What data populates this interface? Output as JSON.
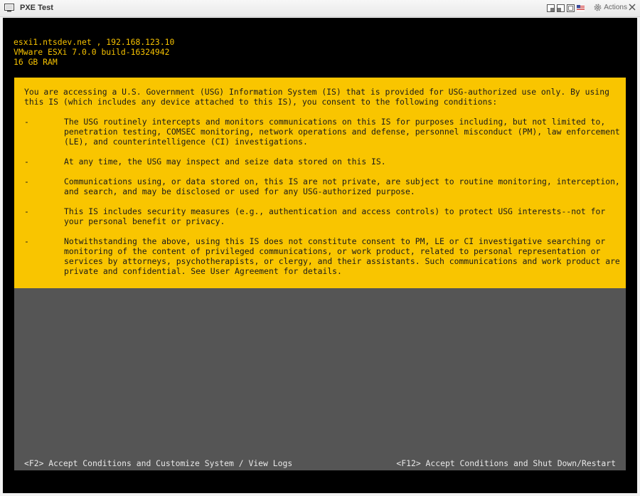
{
  "window": {
    "title": "PXE Test",
    "actions_label": "Actions"
  },
  "console": {
    "host_line": "esxi1.ntsdev.net , 192.168.123.10",
    "version_line": "VMware ESXi 7.0.0 build-16324942",
    "ram_line": "16 GB RAM",
    "banner": {
      "intro": "You are accessing a U.S. Government (USG) Information System (IS) that is provided for USG-authorized use only. By using this IS (which includes any device attached to this IS), you consent to the following conditions:",
      "bullets": [
        {
          "dash": "-",
          "text": "The USG routinely intercepts and monitors communications on this IS for purposes including, but not limited to, penetration testing, COMSEC monitoring, network operations and defense, personnel misconduct (PM), law enforcement (LE), and counterintelligence (CI) investigations."
        },
        {
          "dash": "-",
          "text": "At any time, the USG may inspect and seize data stored on this IS."
        },
        {
          "dash": "-",
          "text": "Communications using, or data stored on, this IS are not private, are subject to routine monitoring, interception, and search, and may be disclosed or used for any USG-authorized purpose."
        },
        {
          "dash": "-",
          "text": "This IS includes security measures (e.g., authentication and access controls) to protect USG interests--not for your personal benefit or privacy."
        },
        {
          "dash": "-",
          "text": "Notwithstanding the above, using this IS does not constitute consent to PM, LE or CI investigative searching or monitoring of the content of privileged communications, or work product, related to personal representation or services by attorneys, psychotherapists, or clergy, and their assistants. Such communications and work product are private and confidential. See User Agreement for details."
        }
      ]
    },
    "footer_left": "<F2> Accept Conditions and Customize System / View Logs",
    "footer_right": "<F12> Accept Conditions and Shut Down/Restart"
  },
  "colors": {
    "console_bg": "#000000",
    "host_text": "#f5c100",
    "banner_bg": "#f9c500",
    "grey_area": "#555555",
    "footer_text": "#e8e8e8"
  },
  "icons": {
    "title": "console-window-icon",
    "toolbar": [
      "window-mode-icon",
      "window-mode-icon-2",
      "fullscreen-icon",
      "keyboard-layout-flag-icon"
    ],
    "actions": "gear-icon",
    "close": "close-icon"
  }
}
